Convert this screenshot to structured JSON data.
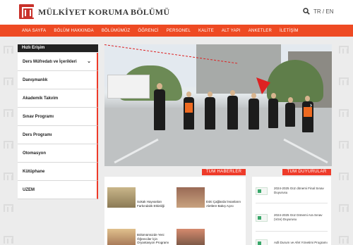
{
  "header": {
    "title": "MÜLKİYET KORUMA BÖLÜMÜ",
    "lang_tr": "TR",
    "lang_sep": "/",
    "lang_en": "EN"
  },
  "nav": {
    "items": [
      "ANA SAYFA",
      "BÖLÜM HAKKINDA",
      "BÖLÜMÜMÜZ",
      "ÖĞRENCİ",
      "PERSONEL",
      "KALİTE",
      "ALT YAPI",
      "ANKETLER",
      "İLETİŞİM"
    ]
  },
  "sidebar": {
    "heading": "Hızlı Erişim",
    "items": [
      {
        "label": "Ders Müfredatı ve İçerikleri",
        "chevron": "⌄"
      },
      {
        "label": "Danışmanlık"
      },
      {
        "label": "Akademik Takvim"
      },
      {
        "label": "Sınav Programı"
      },
      {
        "label": "Ders Programı"
      },
      {
        "label": "Otomasyon"
      },
      {
        "label": "Kütüphane"
      },
      {
        "label": "UZEM"
      }
    ]
  },
  "slider": {
    "next_arrow": "›"
  },
  "news": {
    "button": "TÜM HABERLER",
    "items": [
      {
        "title": "Sokak Hayvanları Farkındalık Etkinliği"
      },
      {
        "title": "Eski Çağlarda İnsanların Aletlere Bakış Açısı"
      },
      {
        "title": "Bölümümüzde Yeni Öğrenciler İçin Oryantasyon Programı"
      }
    ]
  },
  "announcements": {
    "button": "TÜM DUYURULAR",
    "items": [
      {
        "title": "2024-2025 Güz dönemi Final Sınav Duyurusu"
      },
      {
        "title": "2024-2025 Güz Dönemi Ara Sınav (Vize) Duyurusu"
      },
      {
        "title": "Adli Durum ve Afet Yönetimi Programı"
      }
    ]
  },
  "colors": {
    "brand_red": "#ee4a23",
    "accent_red": "#ee3b2a",
    "sidebar_head": "#222222"
  },
  "icons": {
    "search": "search-icon",
    "logo": "university-logo-icon"
  }
}
